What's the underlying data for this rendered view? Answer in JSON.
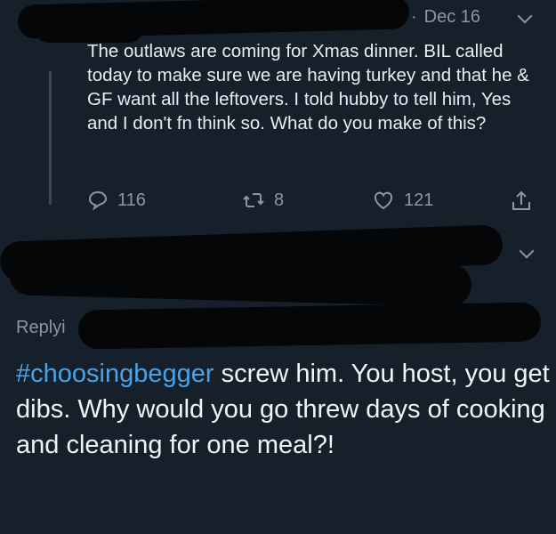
{
  "tweet": {
    "date": "Dec 16",
    "text": "The outlaws are coming for Xmas dinner. BIL called today to make sure we are having turkey and that he & GF want all the leftovers. I told hubby to tell him, Yes and I don't fn think so. What do you make of this?",
    "reply_count": "116",
    "retweet_count": "8",
    "like_count": "121"
  },
  "reply": {
    "replying_label": "Replyi",
    "hashtag": "#choosingbegger",
    "text": " screw him. You host, you get dibs. Why would you go threw days of cooking and cleaning for one meal?!"
  },
  "colors": {
    "background": "#15202b",
    "text": "#e8edf1",
    "muted": "#8a98a5",
    "hashtag": "#4aa3e8",
    "redaction": "#050607"
  },
  "icons": [
    "reply-icon",
    "retweet-icon",
    "like-icon",
    "share-icon",
    "chevron-down-icon"
  ]
}
